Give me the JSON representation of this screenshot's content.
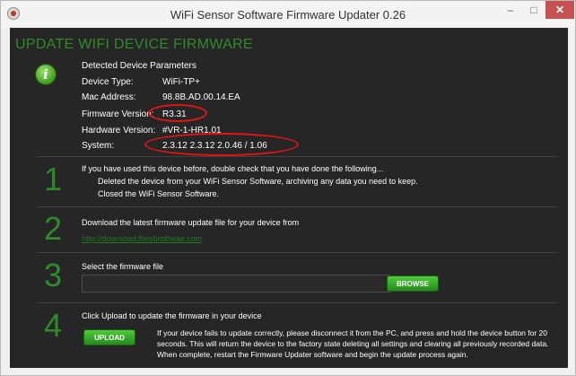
{
  "window": {
    "title": "WiFi Sensor Software Firmware Updater 0.26",
    "minimize": "–",
    "maximize": "□",
    "close": "✕"
  },
  "page": {
    "title": "UPDATE WIFI DEVICE FIRMWARE"
  },
  "device": {
    "heading": "Detected Device Parameters",
    "params": [
      {
        "label": "Device Type:",
        "value": "WiFi-TP+"
      },
      {
        "label": "Mac Address:",
        "value": "98.8B.AD.00.14.EA"
      },
      {
        "label": "Firmware Version:",
        "value": "R3.31"
      },
      {
        "label": "Hardware Version:",
        "value": "#VR-1-HR1.01"
      },
      {
        "label": "System:",
        "value": "2.3.12 2.3.12 2.0.46 / 1.06"
      }
    ]
  },
  "steps": [
    {
      "number": "1",
      "text": "If you have used this device before, double check that you have done the following...",
      "subitems": [
        "Deleted the device from your WiFi Sensor Software, archiving any data you need to keep.",
        "Closed the WiFi Sensor Software."
      ]
    },
    {
      "number": "2",
      "text": "Download the latest firmware update file for your device from",
      "link": "http://download.filesbrotheair.com"
    },
    {
      "number": "3",
      "text": "Select the firmware file",
      "file_value": "",
      "button": "BROWSE"
    },
    {
      "number": "4",
      "text": "Click Upload to update the firmware in your device",
      "button": "UPLOAD",
      "warning": "If your device fails to update correctly, please disconnect it from the PC, and press and hold the device button for 20 seconds. This will return the device to the factory state deleting all settings and clearing all previously recorded data. When complete, restart the Firmware Updater software and begin the update process again."
    }
  ],
  "colors": {
    "accent_green": "#2e8b2a",
    "highlight_red": "#e01414",
    "background": "#262626"
  }
}
